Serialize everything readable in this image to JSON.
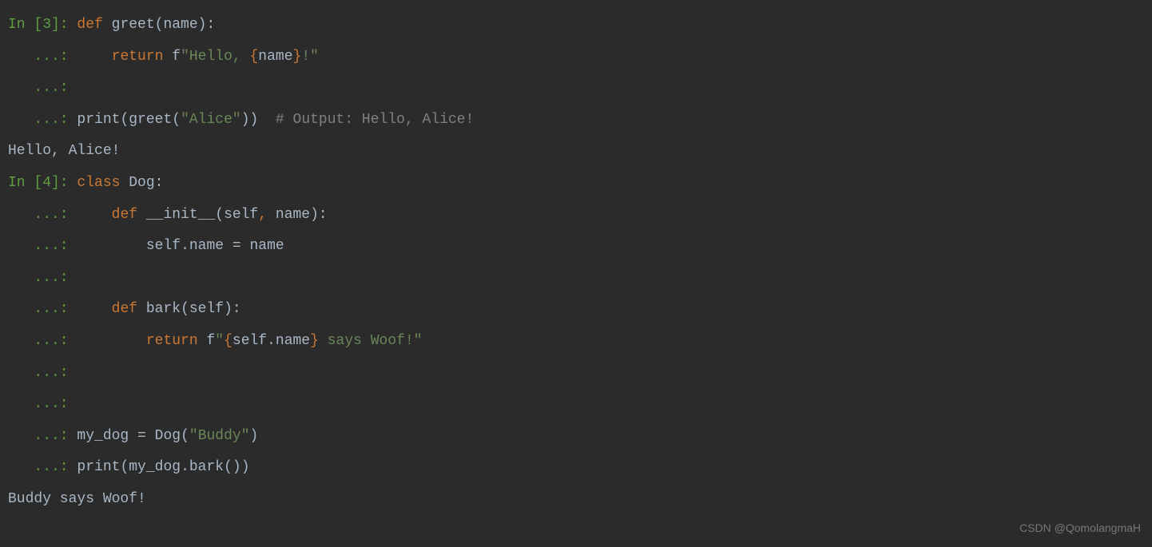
{
  "cell1": {
    "prompt": "In [3]: ",
    "cont": "   ...: ",
    "line1": {
      "def": "def",
      "name": "greet",
      "params": "(name)",
      "colon": ":"
    },
    "line2": {
      "indent": "    ",
      "return": "return",
      "fprefix": " f",
      "str1": "\"Hello, ",
      "brace1": "{",
      "var": "name",
      "brace2": "}",
      "str2": "!\""
    },
    "line4": {
      "print": "print",
      "paren1": "(",
      "call": "greet",
      "paren2": "(",
      "arg": "\"Alice\"",
      "paren3": "))",
      "comment": "  # Output: Hello, Alice!"
    },
    "output": "Hello, Alice!"
  },
  "cell2": {
    "prompt": "In [4]: ",
    "cont": "   ...: ",
    "line1": {
      "class": "class",
      "name": " Dog",
      "colon": ":"
    },
    "line2": {
      "indent": "    ",
      "def": "def",
      "name": " __init__",
      "params": "(self",
      "comma": ",",
      "params2": " name)",
      "colon": ":"
    },
    "line3": {
      "indent": "        ",
      "self": "self",
      "dot": ".",
      "attr": "name ",
      "eq": "=",
      "val": " name"
    },
    "line5": {
      "indent": "    ",
      "def": "def",
      "name": " bark",
      "params": "(self)",
      "colon": ":"
    },
    "line6": {
      "indent": "        ",
      "return": "return",
      "fprefix": " f",
      "str1": "\"",
      "brace1": "{",
      "var": "self.name",
      "brace2": "}",
      "str2": " says Woof!\""
    },
    "line9": {
      "var": "my_dog ",
      "eq": "=",
      "call": " Dog",
      "paren1": "(",
      "arg": "\"Buddy\"",
      "paren2": ")"
    },
    "line10": {
      "print": "print",
      "paren1": "(",
      "expr": "my_dog",
      "dot": ".",
      "method": "bark",
      "paren2": "())"
    },
    "output": "Buddy says Woof!"
  },
  "watermark": "CSDN @QomolangmaH"
}
